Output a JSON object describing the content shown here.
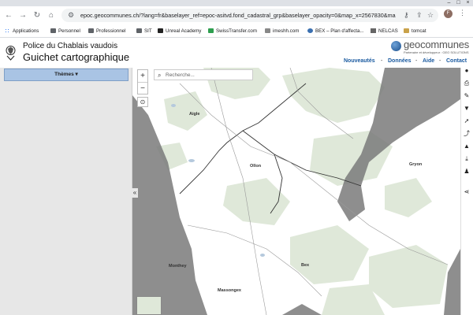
{
  "browser": {
    "url": "epoc.geocommunes.ch/?lang=fr&baselayer_ref=epoc-asitvd.fond_cadastral_grp&baselayer_opacity=0&map_x=2567830&ma...",
    "profile_initial": "F",
    "bookmarks": [
      "Applications",
      "Personnel",
      "Professionnel",
      "SIT",
      "Unreal Academy",
      "SwissTransfer.com",
      "imeshh.com",
      "BEX – Plan d'affecta...",
      "NELCAS",
      "tomcat"
    ]
  },
  "header": {
    "org_title": "Police du Chablais vaudois",
    "app_title": "Guichet cartographique",
    "brand_name": "geocommunes",
    "brand_tagline": "Partenaire et développeur : GEO SOLUTIONS",
    "nav": [
      "Nouveautés",
      "Données",
      "Aide",
      "Contact"
    ],
    "nav_separator": "-"
  },
  "sidebar": {
    "themes_label": "Thèmes ▾",
    "collapse_icon": "«"
  },
  "map": {
    "search_placeholder": "Recherche...",
    "zoom_in": "+",
    "zoom_out": "−",
    "towns": [
      "Aigle",
      "Ollon",
      "Gryon",
      "Bex",
      "Monthey",
      "Massongex"
    ]
  },
  "colors": {
    "nav_link": "#1a5aa0",
    "themes_button": "#a9c4e4",
    "forest": "#dfe8d9",
    "relief": "#7a7a7a"
  }
}
